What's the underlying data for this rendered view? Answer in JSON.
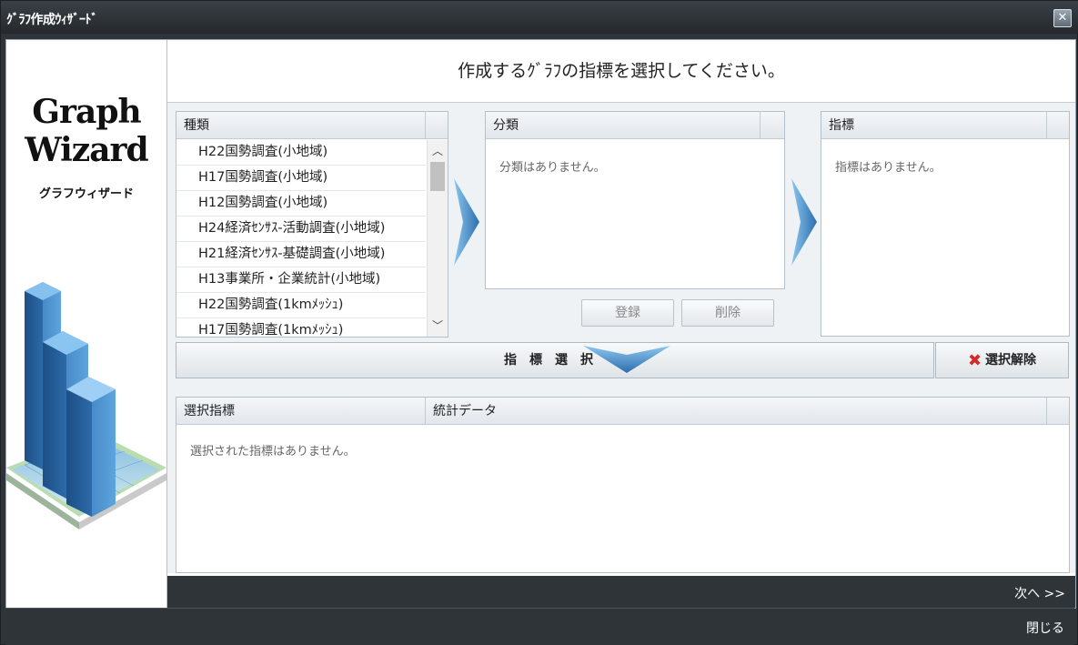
{
  "window": {
    "title": "ｸﾞﾗﾌ作成ｳｨｻﾞｰﾄﾞ",
    "close_icon": "close-icon"
  },
  "sidebar": {
    "logo_line1": "Graph",
    "logo_line2": "Wizard",
    "logo_sub": "グラフウィザード"
  },
  "header": {
    "instruction": "作成するｸﾞﾗﾌの指標を選択してください。"
  },
  "type_panel": {
    "header": "種類",
    "items": [
      "H22国勢調査(小地域)",
      "H17国勢調査(小地域)",
      "H12国勢調査(小地域)",
      "H24経済ｾﾝｻｽ-活動調査(小地域)",
      "H21経済ｾﾝｻｽ-基礎調査(小地域)",
      "H13事業所・企業統計(小地域)",
      "H22国勢調査(1kmﾒｯｼｭ)",
      "H17国勢調査(1kmﾒｯｼｭ)"
    ]
  },
  "category_panel": {
    "header": "分類",
    "empty": "分類はありません。",
    "register_label": "登録",
    "delete_label": "削除"
  },
  "indicator_panel": {
    "header": "指標",
    "empty": "指標はありません。"
  },
  "selection": {
    "select_label": "指標選択",
    "unselect_label": "選択解除"
  },
  "selected_table": {
    "col1": "選択指標",
    "col2": "統計データ",
    "empty": "選択された指標はありません。"
  },
  "footer": {
    "next_label": "次へ >>",
    "close_label": "閉じる"
  },
  "colors": {
    "accent": "#3d86c6",
    "dark": "#2f3438"
  }
}
